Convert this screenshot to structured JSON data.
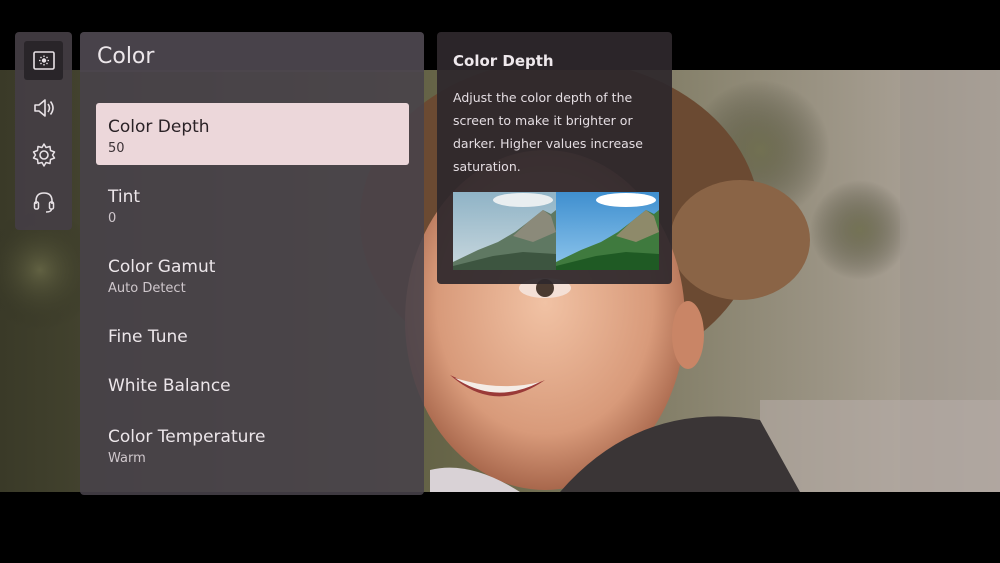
{
  "sidebar": {
    "icons": [
      {
        "name": "picture-icon",
        "active": true
      },
      {
        "name": "sound-icon",
        "active": false
      },
      {
        "name": "settings-gear-icon",
        "active": false
      },
      {
        "name": "support-headset-icon",
        "active": false
      }
    ]
  },
  "panel": {
    "title": "Color",
    "items": [
      {
        "label": "Color Depth",
        "value": "50",
        "selected": true
      },
      {
        "label": "Tint",
        "value": "0",
        "selected": false
      },
      {
        "label": "Color Gamut",
        "value": "Auto Detect",
        "selected": false
      },
      {
        "label": "Fine Tune",
        "value": "",
        "selected": false
      },
      {
        "label": "White Balance",
        "value": "",
        "selected": false
      },
      {
        "label": "Color Temperature",
        "value": "Warm",
        "selected": false
      }
    ]
  },
  "info": {
    "title": "Color Depth",
    "description": "Adjust the color depth of the screen to make it brighter or darker. Higher values increase saturation."
  },
  "colors": {
    "selected_item_bg": "#ecd7da",
    "panel_bg": "#48424a",
    "info_bg": "#2e282c"
  }
}
